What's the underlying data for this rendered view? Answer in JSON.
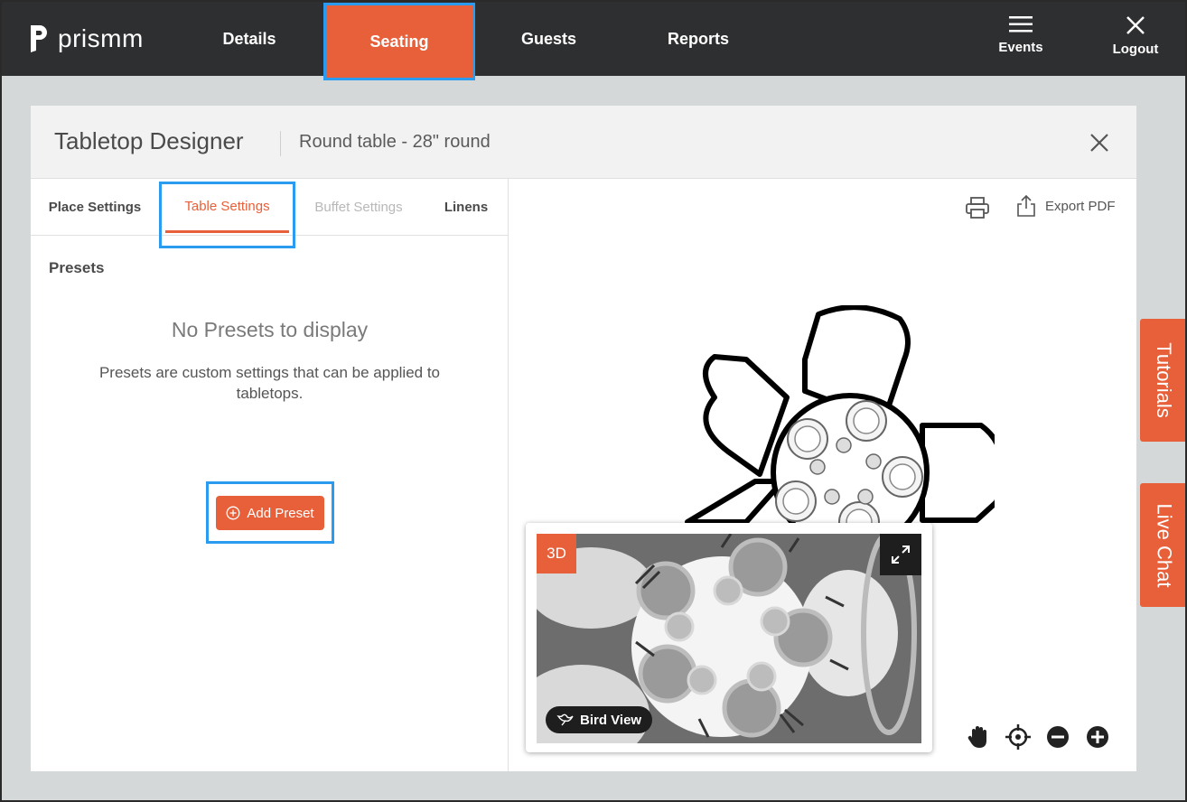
{
  "app": {
    "logo_text": "prismm"
  },
  "nav": {
    "items": [
      {
        "label": "Details"
      },
      {
        "label": "Seating"
      },
      {
        "label": "Guests"
      },
      {
        "label": "Reports"
      }
    ],
    "events_label": "Events",
    "logout_label": "Logout"
  },
  "designer": {
    "title": "Tabletop Designer",
    "subtitle": "Round table - 28\" round",
    "tabs": [
      {
        "label": "Place Settings"
      },
      {
        "label": "Table Settings"
      },
      {
        "label": "Buffet Settings"
      },
      {
        "label": "Linens"
      }
    ],
    "presets_label": "Presets",
    "empty_title": "No Presets to display",
    "empty_description": "Presets are custom settings that can be applied to tabletops.",
    "add_preset_label": "Add Preset",
    "export_label": "Export PDF",
    "preview": {
      "badge": "3D",
      "bird_view_label": "Bird View"
    }
  },
  "side_tabs": {
    "tutorials": "Tutorials",
    "live_chat": "Live Chat"
  },
  "colors": {
    "accent": "#e8603a",
    "nav_bg": "#2e2f31",
    "highlight": "#2b9bf0"
  },
  "icons": [
    "menu-icon",
    "close-icon",
    "print-icon",
    "export-icon",
    "plus-circle-icon",
    "expand-icon",
    "bird-icon",
    "hand-icon",
    "target-icon",
    "zoom-out-icon",
    "zoom-in-icon"
  ]
}
